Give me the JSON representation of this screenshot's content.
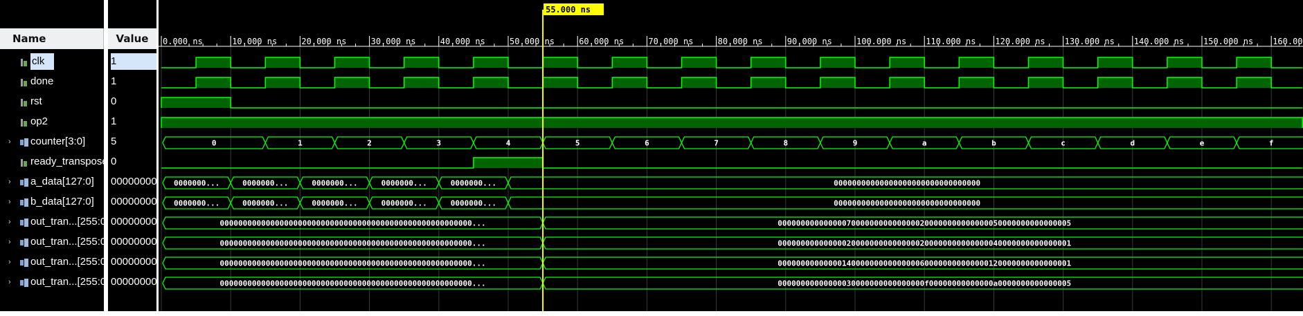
{
  "header": {
    "name_label": "Name",
    "value_label": "Value"
  },
  "cursor": {
    "time_ns": 55,
    "label": "55.000 ns"
  },
  "timeline": {
    "ticks": [
      "0.000 ns",
      "10.000 ns",
      "20.000 ns",
      "30.000 ns",
      "40.000 ns",
      "50.000 ns",
      "60.000 ns",
      "70.000 ns",
      "80.000 ns",
      "90.000 ns",
      "100.000 ns",
      "110.000 ns",
      "120.000 ns",
      "130.000 ns",
      "140.000 ns",
      "150.000 ns",
      "160.000 ns"
    ],
    "visible_range_ns": [
      0,
      164.5
    ]
  },
  "signals": [
    {
      "name": "clk",
      "value": "1",
      "type": "bit",
      "expandable": false,
      "selected": true
    },
    {
      "name": "done",
      "value": "1",
      "type": "bit",
      "expandable": false,
      "selected": false
    },
    {
      "name": "rst",
      "value": "0",
      "type": "bit",
      "expandable": false,
      "selected": false
    },
    {
      "name": "op2",
      "value": "1",
      "type": "bit",
      "expandable": false,
      "selected": false
    },
    {
      "name": "counter[3:0]",
      "value": "5",
      "type": "bus",
      "expandable": true,
      "selected": false
    },
    {
      "name": "ready_transpose",
      "value": "0",
      "type": "bit",
      "expandable": false,
      "selected": false
    },
    {
      "name": "a_data[127:0]",
      "value": "00000000",
      "type": "bus",
      "expandable": true,
      "selected": false
    },
    {
      "name": "b_data[127:0]",
      "value": "00000000",
      "type": "bus",
      "expandable": true,
      "selected": false
    },
    {
      "name": "out_tran...[255:0",
      "value": "00000000",
      "type": "bus",
      "expandable": true,
      "selected": false
    },
    {
      "name": "out_tran...[255:0",
      "value": "00000000",
      "type": "bus",
      "expandable": true,
      "selected": false
    },
    {
      "name": "out_tran...[255:0",
      "value": "00000000",
      "type": "bus",
      "expandable": true,
      "selected": false
    },
    {
      "name": "out_tran...[255:0",
      "value": "00000000",
      "type": "bus",
      "expandable": true,
      "selected": false
    }
  ],
  "waves": {
    "clk": {
      "period_ns": 10,
      "first_rise_ns": 5
    },
    "done": {
      "period_ns": 10,
      "first_rise_ns": 5
    },
    "rst": {
      "high_ranges_ns": [
        [
          0,
          10
        ]
      ]
    },
    "op2": {
      "high_ranges_ns": [
        [
          0,
          164.5
        ]
      ]
    },
    "ready_transpose": {
      "high_ranges_ns": [
        [
          45,
          55
        ]
      ]
    },
    "counter": [
      {
        "from": 0,
        "to": 15,
        "label": "0"
      },
      {
        "from": 15,
        "to": 25,
        "label": "1"
      },
      {
        "from": 25,
        "to": 35,
        "label": "2"
      },
      {
        "from": 35,
        "to": 45,
        "label": "3"
      },
      {
        "from": 45,
        "to": 55,
        "label": "4"
      },
      {
        "from": 55,
        "to": 65,
        "label": "5"
      },
      {
        "from": 65,
        "to": 75,
        "label": "6"
      },
      {
        "from": 75,
        "to": 85,
        "label": "7"
      },
      {
        "from": 85,
        "to": 95,
        "label": "8"
      },
      {
        "from": 95,
        "to": 105,
        "label": "9"
      },
      {
        "from": 105,
        "to": 115,
        "label": "a"
      },
      {
        "from": 115,
        "to": 125,
        "label": "b"
      },
      {
        "from": 125,
        "to": 135,
        "label": "c"
      },
      {
        "from": 135,
        "to": 145,
        "label": "d"
      },
      {
        "from": 145,
        "to": 155,
        "label": "e"
      },
      {
        "from": 155,
        "to": 164.5,
        "label": "f"
      }
    ],
    "a_data": [
      {
        "from": 0,
        "to": 10,
        "label": "0000000..."
      },
      {
        "from": 10,
        "to": 20,
        "label": "0000000..."
      },
      {
        "from": 20,
        "to": 30,
        "label": "0000000..."
      },
      {
        "from": 30,
        "to": 40,
        "label": "0000000..."
      },
      {
        "from": 40,
        "to": 50,
        "label": "0000000..."
      },
      {
        "from": 50,
        "to": 164.5,
        "label": "00000000000000000000000000000000"
      }
    ],
    "b_data": [
      {
        "from": 0,
        "to": 10,
        "label": "0000000..."
      },
      {
        "from": 10,
        "to": 20,
        "label": "0000000..."
      },
      {
        "from": 20,
        "to": 30,
        "label": "0000000..."
      },
      {
        "from": 30,
        "to": 40,
        "label": "0000000..."
      },
      {
        "from": 40,
        "to": 50,
        "label": "0000000..."
      },
      {
        "from": 50,
        "to": 164.5,
        "label": "00000000000000000000000000000000"
      }
    ],
    "out_1": [
      {
        "from": 0,
        "to": 55,
        "label": "0000000000000000000000000000000000000000000000000000000..."
      },
      {
        "from": 55,
        "to": 164.5,
        "label": "0000000000000007000000000000000200000000000000050000000000000005"
      }
    ],
    "out_2": [
      {
        "from": 0,
        "to": 55,
        "label": "0000000000000000000000000000000000000000000000000000000..."
      },
      {
        "from": 55,
        "to": 164.5,
        "label": "0000000000000002000000000000000200000000000000040000000000000001"
      }
    ],
    "out_3": [
      {
        "from": 0,
        "to": 55,
        "label": "0000000000000000000000000000000000000000000000000000000..."
      },
      {
        "from": 55,
        "to": 164.5,
        "label": "0000000000000014000000000000000600000000000000120000000000000001"
      }
    ],
    "out_4": [
      {
        "from": 0,
        "to": 55,
        "label": "0000000000000000000000000000000000000000000000000000000..."
      },
      {
        "from": 55,
        "to": 164.5,
        "label": "00000000000000030000000000000000f00000000000000a0000000000000005"
      }
    ]
  },
  "colors": {
    "wave": "#00ff00",
    "fill": "#006400",
    "cursor": "#ffff00",
    "grid": "#3a3a3a",
    "text": "#ffffff"
  },
  "icons": {
    "bit": "single-bit-signal-icon",
    "bus": "bus-signal-icon"
  }
}
